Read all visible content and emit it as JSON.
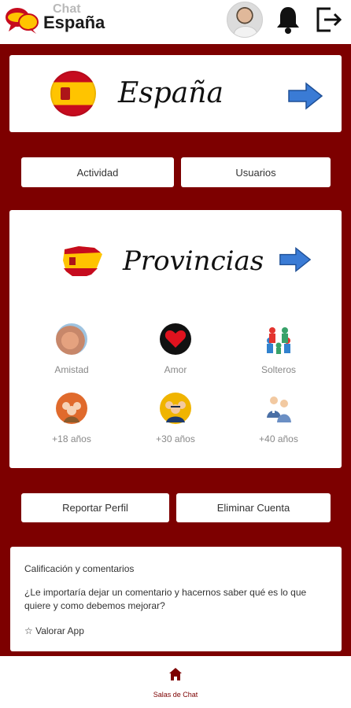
{
  "header": {
    "app_name_small": "Chat",
    "app_name": "España",
    "icons": [
      "chat-bubbles-logo-icon",
      "bell-icon",
      "logout-icon"
    ]
  },
  "espana_card": {
    "title": "España",
    "icon": "spain-flag-circle-icon"
  },
  "buttons": {
    "actividad": "Actividad",
    "usuarios": "Usuarios",
    "reportar": "Reportar Perfil",
    "eliminar": "Eliminar Cuenta"
  },
  "provincias_card": {
    "title": "Provincias",
    "categories": [
      {
        "label": "Amistad",
        "icon": "friendship-hands-icon"
      },
      {
        "label": "Amor",
        "icon": "heart-icon"
      },
      {
        "label": "Solteros",
        "icon": "people-group-icon"
      },
      {
        "label": "+18 años",
        "icon": "women-group-icon"
      },
      {
        "label": "+30 años",
        "icon": "men-group-icon"
      },
      {
        "label": "+40 años",
        "icon": "business-people-icon"
      }
    ]
  },
  "rating": {
    "title": "Calificación y comentarios",
    "text": "¿Le importaría dejar un comentario y hacernos saber qué es lo que quiere y como debemos mejorar?",
    "link": "☆ Valorar App"
  },
  "bottom_nav": {
    "label": "Salas de Chat",
    "icon": "home-icon"
  },
  "colors": {
    "brand": "#7d0000",
    "arrow": "#3a7bd5",
    "flag_red": "#c60b1e",
    "flag_yellow": "#ffc400"
  }
}
